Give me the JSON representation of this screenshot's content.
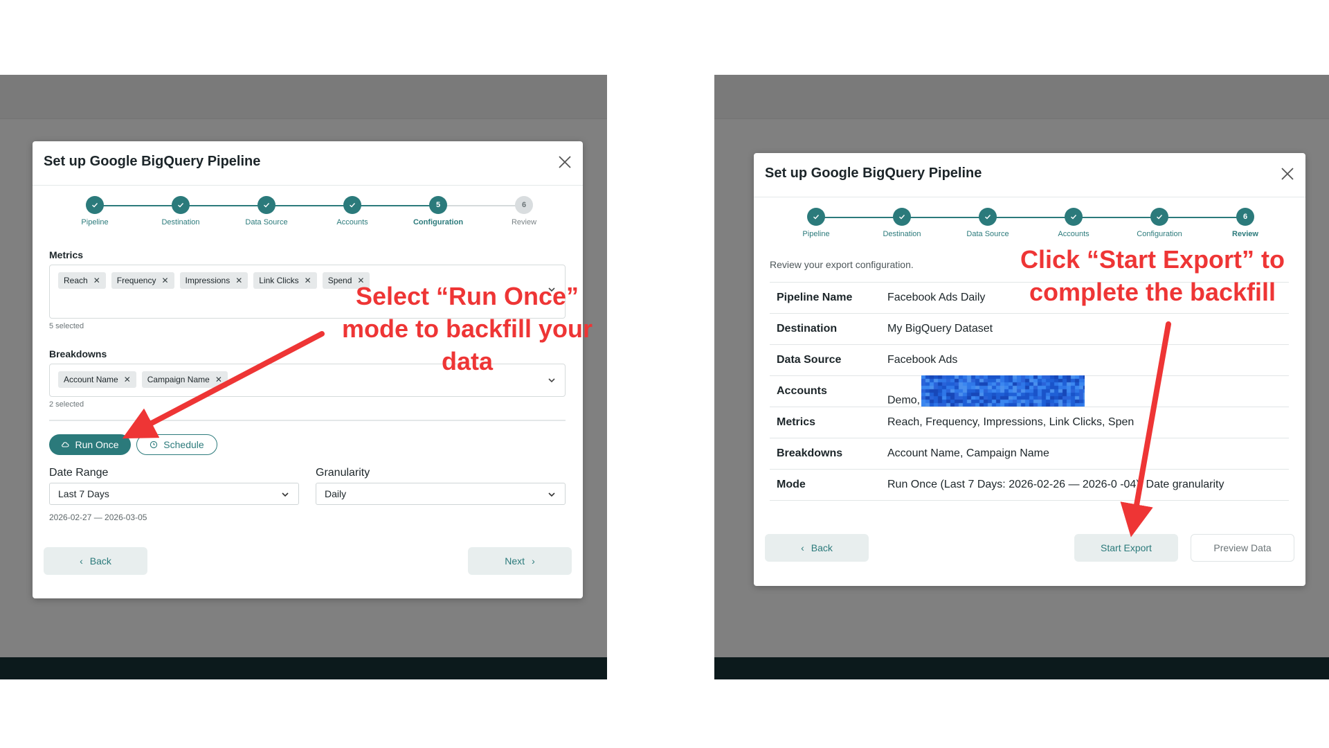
{
  "left": {
    "title": "Set up Google BigQuery Pipeline",
    "steps": [
      {
        "label": "Pipeline",
        "state": "done"
      },
      {
        "label": "Destination",
        "state": "done"
      },
      {
        "label": "Data Source",
        "state": "done"
      },
      {
        "label": "Accounts",
        "state": "done"
      },
      {
        "label": "Configuration",
        "state": "active",
        "num": "5"
      },
      {
        "label": "Review",
        "state": "pending",
        "num": "6"
      }
    ],
    "metrics_label": "Metrics",
    "metrics": [
      "Reach",
      "Frequency",
      "Impressions",
      "Link Clicks",
      "Spend"
    ],
    "metrics_count": "5 selected",
    "breakdowns_label": "Breakdowns",
    "breakdowns": [
      "Account Name",
      "Campaign Name"
    ],
    "breakdowns_count": "2 selected",
    "run_once_label": "Run Once",
    "schedule_label": "Schedule",
    "date_range_label": "Date Range",
    "date_range_value": "Last 7 Days",
    "granularity_label": "Granularity",
    "granularity_value": "Daily",
    "date_hint": "2026-02-27 — 2026-03-05",
    "back_label": "Back",
    "next_label": "Next"
  },
  "right": {
    "title": "Set up Google BigQuery Pipeline",
    "steps": [
      {
        "label": "Pipeline",
        "state": "done"
      },
      {
        "label": "Destination",
        "state": "done"
      },
      {
        "label": "Data Source",
        "state": "done"
      },
      {
        "label": "Accounts",
        "state": "done"
      },
      {
        "label": "Configuration",
        "state": "done"
      },
      {
        "label": "Review",
        "state": "active",
        "num": "6"
      }
    ],
    "intro": "Review your export configuration.",
    "rows": [
      {
        "key": "Pipeline Name",
        "value": "Facebook Ads Daily"
      },
      {
        "key": "Destination",
        "value": "My BigQuery Dataset"
      },
      {
        "key": "Data Source",
        "value": "Facebook Ads"
      },
      {
        "key": "Accounts",
        "value": "Demo,"
      },
      {
        "key": "Metrics",
        "value": "Reach, Frequency, Impressions, Link Clicks, Spen"
      },
      {
        "key": "Breakdowns",
        "value": "Account Name, Campaign Name"
      },
      {
        "key": "Mode",
        "value": "Run Once (Last 7 Days: 2026-02-26 — 2026-0 -04), Date granularity"
      }
    ],
    "back_label": "Back",
    "start_export_label": "Start Export",
    "preview_label": "Preview Data"
  },
  "annotations": {
    "left": "Select “Run Once” mode to backfill your data",
    "right": "Click “Start Export” to complete the backfill"
  },
  "colors": {
    "accent": "#2b7a7b",
    "annotation": "#ee3535",
    "overlay": "#808080"
  }
}
